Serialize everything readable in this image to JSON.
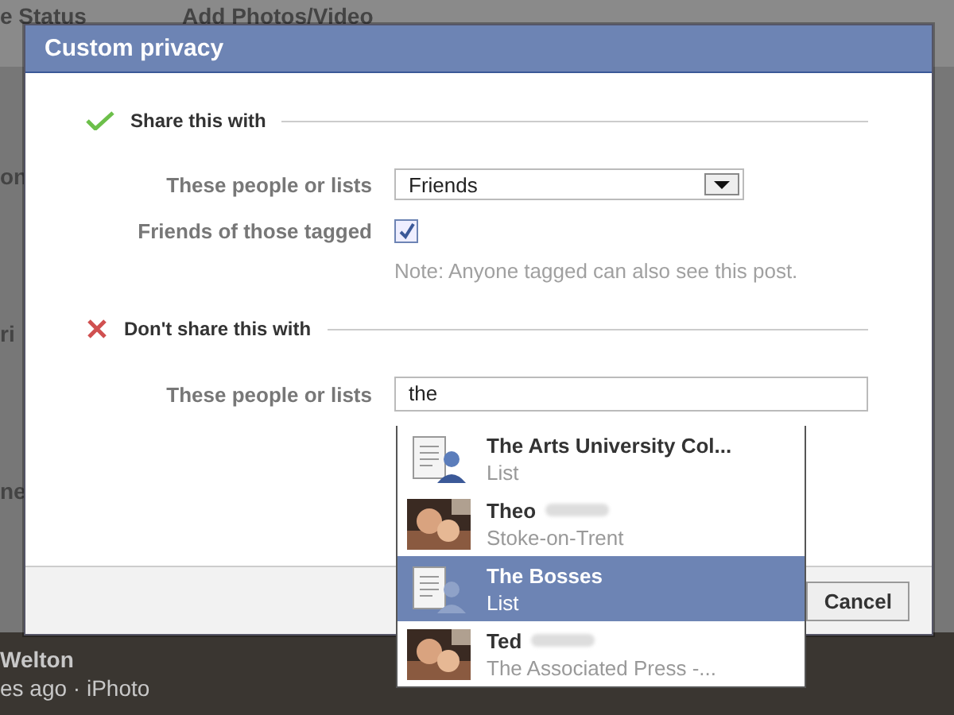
{
  "background": {
    "top_texts": [
      "e Status",
      "Add Photos/Video"
    ],
    "side_texts": [
      "on",
      "ri",
      "ne"
    ],
    "bottom_texts": [
      "Welton",
      "es ago · iPhoto"
    ]
  },
  "dialog": {
    "title": "Custom privacy",
    "share": {
      "heading": "Share this with",
      "label": "These people or lists",
      "select_value": "Friends"
    },
    "tagged": {
      "label": "Friends of those tagged",
      "checked": true,
      "note": "Note: Anyone tagged can also see this post."
    },
    "dont_share": {
      "heading": "Don't share this with",
      "label": "These people or lists",
      "value": "the"
    },
    "cancel": "Cancel"
  },
  "suggestions": [
    {
      "kind": "list",
      "name": "The Arts University Col...",
      "detail": "List",
      "selected": false
    },
    {
      "kind": "person",
      "name": "Theo",
      "detail": "Stoke-on-Trent",
      "selected": false
    },
    {
      "kind": "list",
      "name": "The Bosses",
      "detail": "List",
      "selected": true
    },
    {
      "kind": "person",
      "name": "Ted",
      "detail": "The Associated Press -...",
      "selected": false
    }
  ]
}
